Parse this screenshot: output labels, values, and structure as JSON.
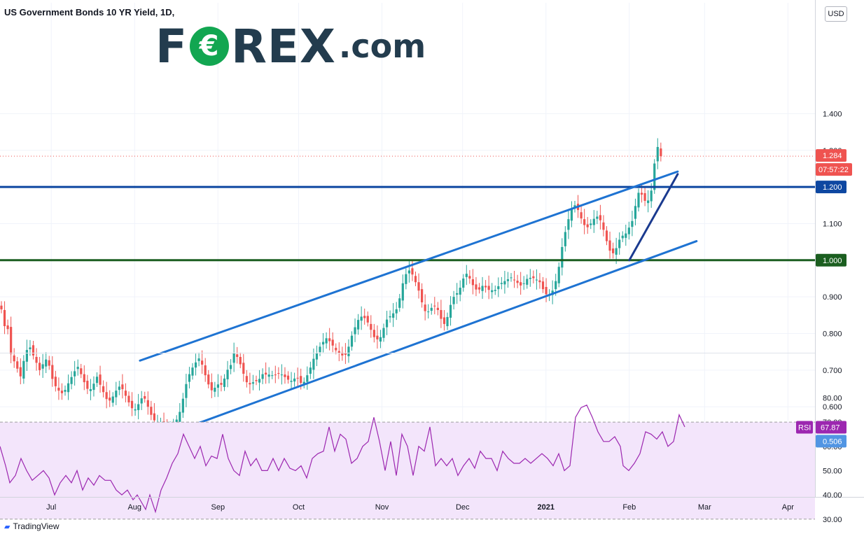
{
  "header": {
    "title": "US Government Bonds 10 YR Yield, 1D,"
  },
  "logo": {
    "left": "F",
    "o": "€",
    "right": "REX",
    "suffix": ".com"
  },
  "currency": "USD",
  "footer": {
    "brand": "TradingView"
  },
  "colors": {
    "up": "#26a69a",
    "down": "#ef5350",
    "channel": "#1e73d2",
    "rsi": "#9c27b0",
    "rsi_band": "#f3e5fb",
    "green_level": "#1b5e20",
    "navy_level": "#0d47a1",
    "blue_level": "#5195e3"
  },
  "chart_data": [
    {
      "type": "candlestick",
      "title": "US Government Bonds 10 YR Yield, 1D",
      "y_ticks": [
        1.4,
        1.3,
        1.2,
        1.1,
        1.0,
        0.9,
        0.8,
        0.7,
        0.6
      ],
      "y_tick_labels": [
        "1.400",
        "1.300",
        "1.200",
        "1.100",
        "1.000",
        "0.900",
        "0.800",
        "0.700",
        "0.600"
      ],
      "ylim": [
        0.5,
        1.41
      ],
      "x_ticks": [
        "Jul",
        "Aug",
        "Sep",
        "Oct",
        "Nov",
        "Dec",
        "2021",
        "Feb",
        "Mar",
        "Apr"
      ],
      "last_price": "1.284",
      "countdown": "07:57:22",
      "horizontal_levels": [
        {
          "value": 1.2,
          "label": "1.200",
          "color": "#0d47a1"
        },
        {
          "value": 1.0,
          "label": "1.000",
          "color": "#1b5e20"
        },
        {
          "value": 0.506,
          "label": "0.506",
          "color": "#5195e3"
        }
      ],
      "trendlines": [
        {
          "name": "channel-upper",
          "start": [
            "2020-08-03",
            0.726
          ],
          "end": [
            "2021-02-19",
            1.242
          ]
        },
        {
          "name": "channel-lower",
          "start": [
            "2020-08-06",
            0.505
          ],
          "end": [
            "2021-02-26",
            1.052
          ]
        },
        {
          "name": "rising-support",
          "start": [
            "2021-02-01",
            1.0
          ],
          "end": [
            "2021-02-19",
            1.235
          ]
        }
      ],
      "close": [
        0.866,
        0.82,
        0.812,
        0.744,
        0.724,
        0.704,
        0.683,
        0.725,
        0.755,
        0.762,
        0.74,
        0.72,
        0.7,
        0.716,
        0.729,
        0.712,
        0.676,
        0.656,
        0.644,
        0.637,
        0.646,
        0.664,
        0.681,
        0.697,
        0.709,
        0.689,
        0.667,
        0.649,
        0.648,
        0.663,
        0.682,
        0.66,
        0.64,
        0.621,
        0.617,
        0.628,
        0.644,
        0.655,
        0.648,
        0.63,
        0.612,
        0.596,
        0.593,
        0.607,
        0.623,
        0.622,
        0.6,
        0.578,
        0.563,
        0.558,
        0.558,
        0.544,
        0.53,
        0.532,
        0.547,
        0.565,
        0.586,
        0.622,
        0.662,
        0.689,
        0.707,
        0.721,
        0.732,
        0.715,
        0.686,
        0.661,
        0.645,
        0.652,
        0.661,
        0.66,
        0.677,
        0.701,
        0.714,
        0.747,
        0.736,
        0.716,
        0.69,
        0.667,
        0.661,
        0.667,
        0.67,
        0.676,
        0.689,
        0.688,
        0.688,
        0.686,
        0.686,
        0.69,
        0.688,
        0.681,
        0.674,
        0.671,
        0.677,
        0.678,
        0.665,
        0.668,
        0.686,
        0.707,
        0.731,
        0.747,
        0.764,
        0.777,
        0.787,
        0.779,
        0.767,
        0.754,
        0.746,
        0.74,
        0.742,
        0.764,
        0.794,
        0.817,
        0.837,
        0.846,
        0.842,
        0.83,
        0.81,
        0.79,
        0.784,
        0.79,
        0.815,
        0.838,
        0.847,
        0.855,
        0.866,
        0.896,
        0.937,
        0.962,
        0.972,
        0.961,
        0.94,
        0.917,
        0.885,
        0.861,
        0.86,
        0.87,
        0.874,
        0.864,
        0.84,
        0.826,
        0.845,
        0.878,
        0.9,
        0.91,
        0.925,
        0.95,
        0.963,
        0.95,
        0.932,
        0.92,
        0.92,
        0.93,
        0.926,
        0.919,
        0.918,
        0.919,
        0.929,
        0.938,
        0.943,
        0.948,
        0.953,
        0.946,
        0.938,
        0.931,
        0.937,
        0.949,
        0.952,
        0.951,
        0.947,
        0.94,
        0.921,
        0.907,
        0.905,
        0.917,
        0.943,
        0.982,
        1.036,
        1.077,
        1.112,
        1.141,
        1.15,
        1.137,
        1.114,
        1.096,
        1.09,
        1.1,
        1.113,
        1.119,
        1.109,
        1.083,
        1.052,
        1.026,
        1.019,
        1.033,
        1.056,
        1.067,
        1.073,
        1.089,
        1.107,
        1.148,
        1.184,
        1.179,
        1.162,
        1.163,
        1.19,
        1.264,
        1.309,
        1.284
      ],
      "rsi": {
        "name": "RSI",
        "value_label": "67.87",
        "y_ticks": [
          80,
          70,
          60,
          50,
          40,
          30
        ],
        "y_tick_labels": [
          "80.00",
          "70.00",
          "60.00",
          "50.00",
          "40.00",
          "30.00"
        ],
        "ylim": [
          25,
          85
        ],
        "band": [
          30,
          70
        ],
        "points": [
          [
            0,
            60
          ],
          [
            8,
            52
          ],
          [
            14,
            45
          ],
          [
            22,
            48
          ],
          [
            30,
            55
          ],
          [
            38,
            50
          ],
          [
            46,
            46
          ],
          [
            54,
            48
          ],
          [
            62,
            50
          ],
          [
            70,
            47
          ],
          [
            78,
            40
          ],
          [
            86,
            45
          ],
          [
            94,
            48
          ],
          [
            102,
            45
          ],
          [
            110,
            50
          ],
          [
            118,
            42
          ],
          [
            126,
            47
          ],
          [
            134,
            44
          ],
          [
            142,
            48
          ],
          [
            150,
            46
          ],
          [
            158,
            46
          ],
          [
            166,
            42
          ],
          [
            174,
            40
          ],
          [
            182,
            42
          ],
          [
            190,
            38
          ],
          [
            196,
            40
          ],
          [
            202,
            37
          ],
          [
            208,
            34
          ],
          [
            214,
            40
          ],
          [
            222,
            33
          ],
          [
            230,
            42
          ],
          [
            238,
            47
          ],
          [
            246,
            53
          ],
          [
            254,
            57
          ],
          [
            262,
            65
          ],
          [
            270,
            60
          ],
          [
            278,
            55
          ],
          [
            286,
            60
          ],
          [
            294,
            52
          ],
          [
            302,
            56
          ],
          [
            310,
            55
          ],
          [
            318,
            65
          ],
          [
            326,
            55
          ],
          [
            334,
            50
          ],
          [
            342,
            48
          ],
          [
            350,
            58
          ],
          [
            358,
            52
          ],
          [
            366,
            55
          ],
          [
            374,
            50
          ],
          [
            382,
            50
          ],
          [
            390,
            55
          ],
          [
            398,
            50
          ],
          [
            406,
            55
          ],
          [
            414,
            51
          ],
          [
            422,
            50
          ],
          [
            430,
            52
          ],
          [
            438,
            47
          ],
          [
            446,
            55
          ],
          [
            454,
            57
          ],
          [
            462,
            58
          ],
          [
            470,
            68
          ],
          [
            478,
            58
          ],
          [
            486,
            65
          ],
          [
            494,
            63
          ],
          [
            502,
            53
          ],
          [
            510,
            55
          ],
          [
            518,
            60
          ],
          [
            526,
            62
          ],
          [
            534,
            72
          ],
          [
            542,
            62
          ],
          [
            550,
            50
          ],
          [
            558,
            62
          ],
          [
            566,
            48
          ],
          [
            574,
            65
          ],
          [
            582,
            60
          ],
          [
            590,
            48
          ],
          [
            598,
            60
          ],
          [
            606,
            58
          ],
          [
            614,
            68
          ],
          [
            622,
            52
          ],
          [
            630,
            55
          ],
          [
            638,
            52
          ],
          [
            646,
            55
          ],
          [
            654,
            48
          ],
          [
            662,
            52
          ],
          [
            670,
            55
          ],
          [
            678,
            51
          ],
          [
            686,
            58
          ],
          [
            694,
            55
          ],
          [
            702,
            55
          ],
          [
            710,
            50
          ],
          [
            718,
            58
          ],
          [
            726,
            55
          ],
          [
            734,
            53
          ],
          [
            742,
            53
          ],
          [
            750,
            55
          ],
          [
            758,
            53
          ],
          [
            766,
            55
          ],
          [
            774,
            57
          ],
          [
            782,
            55
          ],
          [
            790,
            52
          ],
          [
            798,
            57
          ],
          [
            806,
            50
          ],
          [
            814,
            52
          ],
          [
            822,
            72
          ],
          [
            830,
            76
          ],
          [
            838,
            77
          ],
          [
            846,
            72
          ],
          [
            854,
            66
          ],
          [
            862,
            62
          ],
          [
            870,
            62
          ],
          [
            878,
            64
          ],
          [
            886,
            60
          ],
          [
            890,
            52
          ],
          [
            898,
            50
          ],
          [
            906,
            53
          ],
          [
            914,
            57
          ],
          [
            922,
            66
          ],
          [
            930,
            65
          ],
          [
            938,
            63
          ],
          [
            946,
            66
          ],
          [
            954,
            60
          ],
          [
            962,
            62
          ],
          [
            970,
            73
          ],
          [
            978,
            68
          ]
        ]
      }
    }
  ]
}
